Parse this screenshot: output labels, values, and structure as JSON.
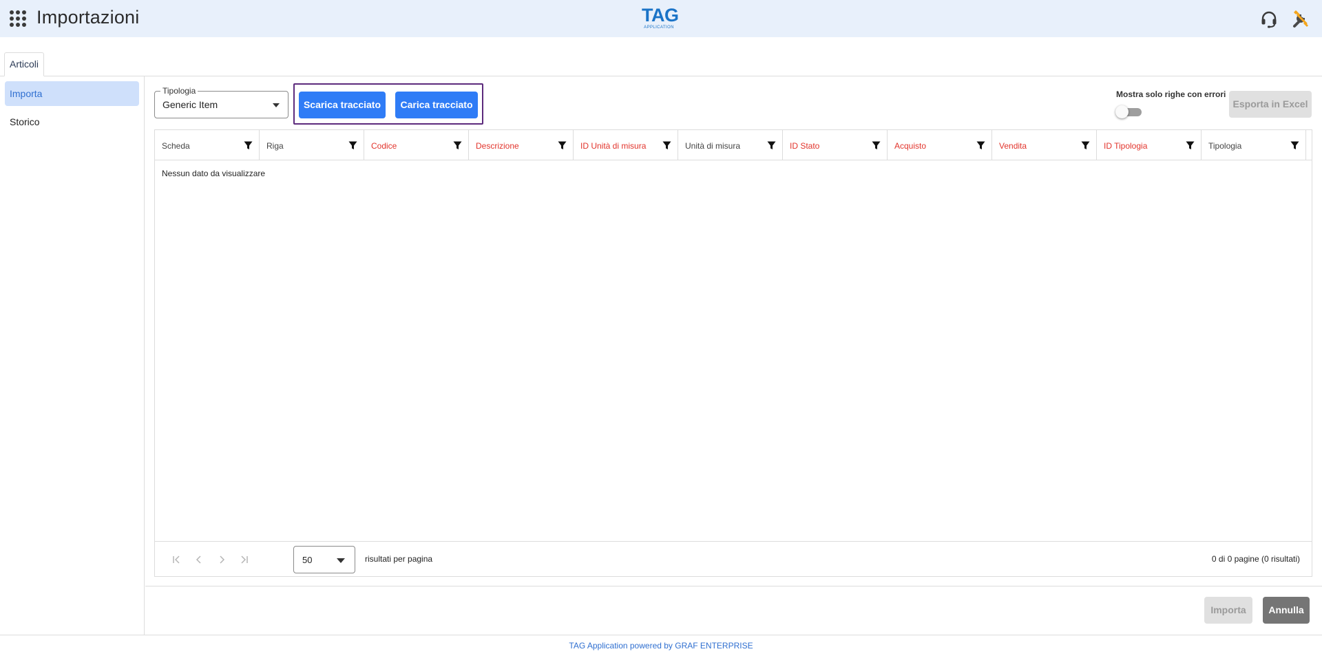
{
  "header": {
    "title": "Importazioni",
    "logo_main": "TAG",
    "logo_sub": "APPLICATION",
    "icons": [
      "apps-grid-icon",
      "headset-support-icon",
      "tools-wrench-screwdriver-icon"
    ]
  },
  "tabs": [
    {
      "label": "Articoli",
      "active": true
    }
  ],
  "sidebar": {
    "items": [
      {
        "label": "Importa",
        "active": true
      },
      {
        "label": "Storico",
        "active": false
      }
    ]
  },
  "toolbar": {
    "tipologia": {
      "label": "Tipologia",
      "value": "Generic Item"
    },
    "download_label": "Scarica tracciato",
    "upload_label": "Carica tracciato",
    "errors_only_label": "Mostra solo righe con errori",
    "errors_only_on": false,
    "export_label": "Esporta in Excel"
  },
  "grid": {
    "columns": [
      {
        "label": "Scheda",
        "required": false
      },
      {
        "label": "Riga",
        "required": false
      },
      {
        "label": "Codice",
        "required": true
      },
      {
        "label": "Descrizione",
        "required": true
      },
      {
        "label": "ID Unità di misura",
        "required": true
      },
      {
        "label": "Unità di misura",
        "required": false
      },
      {
        "label": "ID Stato",
        "required": true
      },
      {
        "label": "Acquisto",
        "required": true
      },
      {
        "label": "Vendita",
        "required": true
      },
      {
        "label": "ID Tipologia",
        "required": true
      },
      {
        "label": "Tipologia",
        "required": false
      }
    ],
    "empty_message": "Nessun dato da visualizzare"
  },
  "pager": {
    "page_size": "50",
    "per_page_label": "risultati per pagina",
    "info": "0 di 0 pagine (0 risultati)"
  },
  "actions": {
    "import_label": "Importa",
    "cancel_label": "Annulla"
  },
  "footer": {
    "text": "TAG Application powered by GRAF ENTERPRISE"
  },
  "colors": {
    "header_bg": "#e8f0fb",
    "primary": "#2f7cf6",
    "required_column": "#e2332b",
    "highlight_border": "#5c2a7c",
    "sidebar_active_bg": "#cfe0fb",
    "footer_text": "#2f6fd0"
  }
}
